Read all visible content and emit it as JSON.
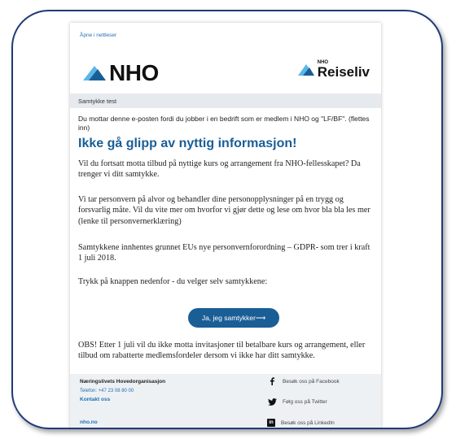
{
  "email": {
    "browser_link": "Åpne i nettleser",
    "logo_main": "NHO",
    "logo_partner_small": "NHO",
    "logo_partner_big": "Reiseliv",
    "subject": "Samtykke test",
    "intro": "Du mottar denne e-posten fordi du jobber i en bedrift som er medlem i NHO og \"LF/BF\". (flettes inn)",
    "headline": "Ikke gå glipp av nyttig informasjon!",
    "paragraphs": [
      "Vil du fortsatt motta tilbud på nyttige kurs og arrangement fra NHO-fellesskapet? Da trenger vi ditt samtykke.",
      "Vi tar personvern på alvor og behandler dine personopplysninger på en trygg og forsvarlig måte. Vil du vite mer om hvorfor vi gjør dette og lese om hvor bla bla les mer (lenke til personvernerklæring)",
      "Samtykkene innhentes grunnet EUs nye personvernforordning – GDPR- som trer i kraft 1 juli 2018.",
      "Trykk på knappen nedenfor - du velger selv samtykkene:",
      "OBS! Etter 1 juli vil du ikke motta invitasjoner til betalbare kurs og arrangement, eller tilbud om rabatterte medlemsfordeler dersom vi ikke har ditt samtykke."
    ],
    "cta_label": "Ja, jeg samtykker⟶",
    "footer": {
      "org": "Næringslivets Hovedorganisasjon",
      "phone": "Telefon: +47 23 08 80 00",
      "contact": "Kontakt oss",
      "site": "nho.no",
      "social": [
        {
          "label": "Besøk oss på Facebook",
          "icon": "facebook-icon"
        },
        {
          "label": "Følg oss på Twitter",
          "icon": "twitter-icon"
        },
        {
          "label": "Besøk oss på LinkedIn",
          "icon": "linkedin-icon"
        }
      ]
    }
  },
  "colors": {
    "frame_border": "#1f3a78",
    "brand_blue": "#1a5e96",
    "link_blue": "#1f6fb2",
    "footer_bg": "#eef1f4"
  }
}
